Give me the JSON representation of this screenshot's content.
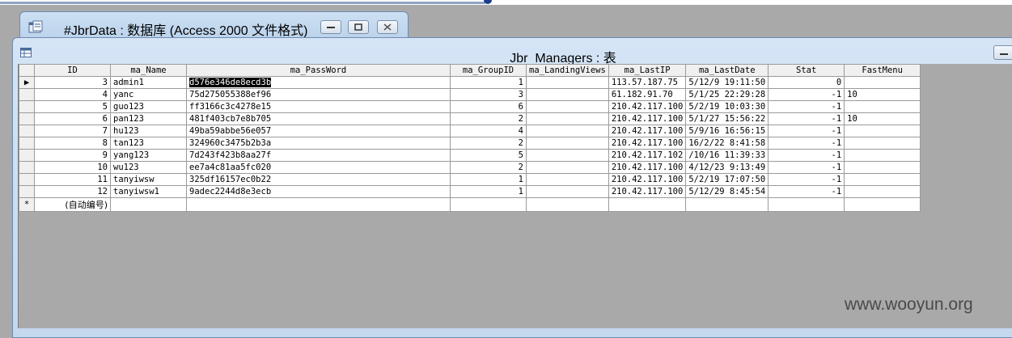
{
  "db_window": {
    "title": "#JbrData : 数据库 (Access 2000 文件格式)",
    "buttons": [
      "minimize",
      "restore",
      "close"
    ]
  },
  "table_window": {
    "title": "Jbr_Managers : 表"
  },
  "grid": {
    "columns": [
      "ID",
      "ma_Name",
      "ma_PassWord",
      "ma_GroupID",
      "ma_LandingViews",
      "ma_LastIP",
      "ma_LastDate",
      "Stat",
      "FastMenu"
    ],
    "rows": [
      {
        "id": "3",
        "name": "admin1",
        "pass": "d576e346de8ecd3b",
        "group": "1",
        "views": "",
        "ip": "113.57.187.75",
        "date": "5/12/9 19:11:50",
        "stat": "0",
        "fast": ""
      },
      {
        "id": "4",
        "name": "yanc",
        "pass": "75d275055388ef96",
        "group": "3",
        "views": "",
        "ip": "61.182.91.70",
        "date": "5/1/25 22:29:28",
        "stat": "-1",
        "fast": "10"
      },
      {
        "id": "5",
        "name": "guo123",
        "pass": "ff3166c3c4278e15",
        "group": "6",
        "views": "",
        "ip": "210.42.117.100",
        "date": "5/2/19 10:03:30",
        "stat": "-1",
        "fast": ""
      },
      {
        "id": "6",
        "name": "pan123",
        "pass": "481f403cb7e8b705",
        "group": "2",
        "views": "",
        "ip": "210.42.117.100",
        "date": "5/1/27 15:56:22",
        "stat": "-1",
        "fast": "10"
      },
      {
        "id": "7",
        "name": "hu123",
        "pass": "49ba59abbe56e057",
        "group": "4",
        "views": "",
        "ip": "210.42.117.100",
        "date": "5/9/16 16:56:15",
        "stat": "-1",
        "fast": ""
      },
      {
        "id": "8",
        "name": "tan123",
        "pass": "324960c3475b2b3a",
        "group": "2",
        "views": "",
        "ip": "210.42.117.100",
        "date": "16/2/22 8:41:58",
        "stat": "-1",
        "fast": ""
      },
      {
        "id": "9",
        "name": "yang123",
        "pass": "7d243f423b8aa27f",
        "group": "5",
        "views": "",
        "ip": "210.42.117.102",
        "date": "/10/16 11:39:33",
        "stat": "-1",
        "fast": ""
      },
      {
        "id": "10",
        "name": "wu123",
        "pass": "ee7a4c81aa5fc020",
        "group": "2",
        "views": "",
        "ip": "210.42.117.100",
        "date": "4/12/23 9:13:49",
        "stat": "-1",
        "fast": ""
      },
      {
        "id": "11",
        "name": "tanyiwsw",
        "pass": "325df16157ec0b22",
        "group": "1",
        "views": "",
        "ip": "210.42.117.100",
        "date": "5/2/19 17:07:50",
        "stat": "-1",
        "fast": ""
      },
      {
        "id": "12",
        "name": "tanyiwsw1",
        "pass": "9adec2244d8e3ecb",
        "group": "1",
        "views": "",
        "ip": "210.42.117.100",
        "date": "5/12/29 8:45:54",
        "stat": "-1",
        "fast": ""
      }
    ],
    "new_row": {
      "marker": "*",
      "autonumber": "(自动编号)"
    },
    "current_row_marker": "▶"
  },
  "watermark": "www.wooyun.org",
  "colors": {
    "background": "#a9a9a9",
    "title_bar": "#c4d8ee",
    "selection": "#000000"
  }
}
